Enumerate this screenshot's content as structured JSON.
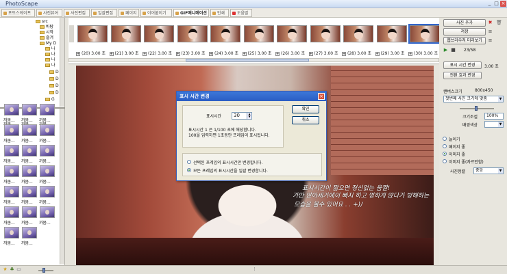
{
  "app": {
    "title": "PhotoScape"
  },
  "tabs": [
    {
      "label": "포토스케이프",
      "active": false
    },
    {
      "label": "사진뷰어",
      "active": false
    },
    {
      "label": "사진편집",
      "active": false
    },
    {
      "label": "일괄편집",
      "active": false
    },
    {
      "label": "페이지",
      "active": false
    },
    {
      "label": "이어붙이기",
      "active": false
    },
    {
      "label": "GIF애니메이션",
      "active": true
    },
    {
      "label": "인쇄",
      "active": false
    },
    {
      "label": "도움말",
      "active": false
    }
  ],
  "tree": {
    "items": [
      "src",
      "바탕",
      "시작",
      "즐겨",
      "My D",
      "나",
      "나",
      "나",
      "나",
      "D",
      "D",
      "D",
      "D",
      "G"
    ]
  },
  "thumbs": {
    "label": "까봄..."
  },
  "filmstrip": {
    "frames": [
      {
        "label": "(20) 3.00 초"
      },
      {
        "label": "(21) 3.00 초"
      },
      {
        "label": "(22) 3.00 초"
      },
      {
        "label": "(23) 3.00 초"
      },
      {
        "label": "(24) 3.00 초"
      },
      {
        "label": "(25) 3.00 초"
      },
      {
        "label": "(26) 3.00 초"
      },
      {
        "label": "(27) 3.00 초"
      },
      {
        "label": "(28) 3.00 초"
      },
      {
        "label": "(29) 3.00 초"
      },
      {
        "label": "(30) 3.00 초"
      }
    ]
  },
  "photo": {
    "caption1": "표시시간이 짧으면 정신없는 움짤!",
    "caption2": "가만 앉아세가에이 빠지 하고 멍하게 앉다가 방해하는",
    "caption3": "모습을 볼수 있어요 . . +)/"
  },
  "dialog": {
    "title": "표시 시간 변경",
    "field_label": "표시시간",
    "value": "30",
    "desc1": "표시시간 1 은 1/100 초에 해당합니다.",
    "desc2": "100을 입력하면 1초동안 프레임이 표시됩니다.",
    "ok": "확인",
    "cancel": "취소",
    "radio1": "선택된 프레임의 표시시간만 변경합니다.",
    "radio2": "모든 프레임의 표시시간을 일괄 변경합니다.",
    "selected_radio": "radio2"
  },
  "right": {
    "add_photo": "사진 추가",
    "save": "저장",
    "preview": "웹브라우저 미리보기",
    "counter": "23/58",
    "change_time": "표시 시간 변경",
    "time_value": "3.00 초",
    "transition": "전환 효과 변경",
    "canvas_label": "캔버스크기",
    "canvas_value": "800x450",
    "fit_select": "첫번째 사진 크기에 맞춤",
    "zoom_label": "크기조절",
    "zoom_value": "100%",
    "bg_label": "배경색상",
    "options": [
      "늘이기",
      "페이지 좋",
      "이미지 좋",
      "이미지 좋(자르안함)"
    ],
    "selected_option": "이미지 좋",
    "align_label": "사진정렬",
    "align_value": "중앙"
  }
}
